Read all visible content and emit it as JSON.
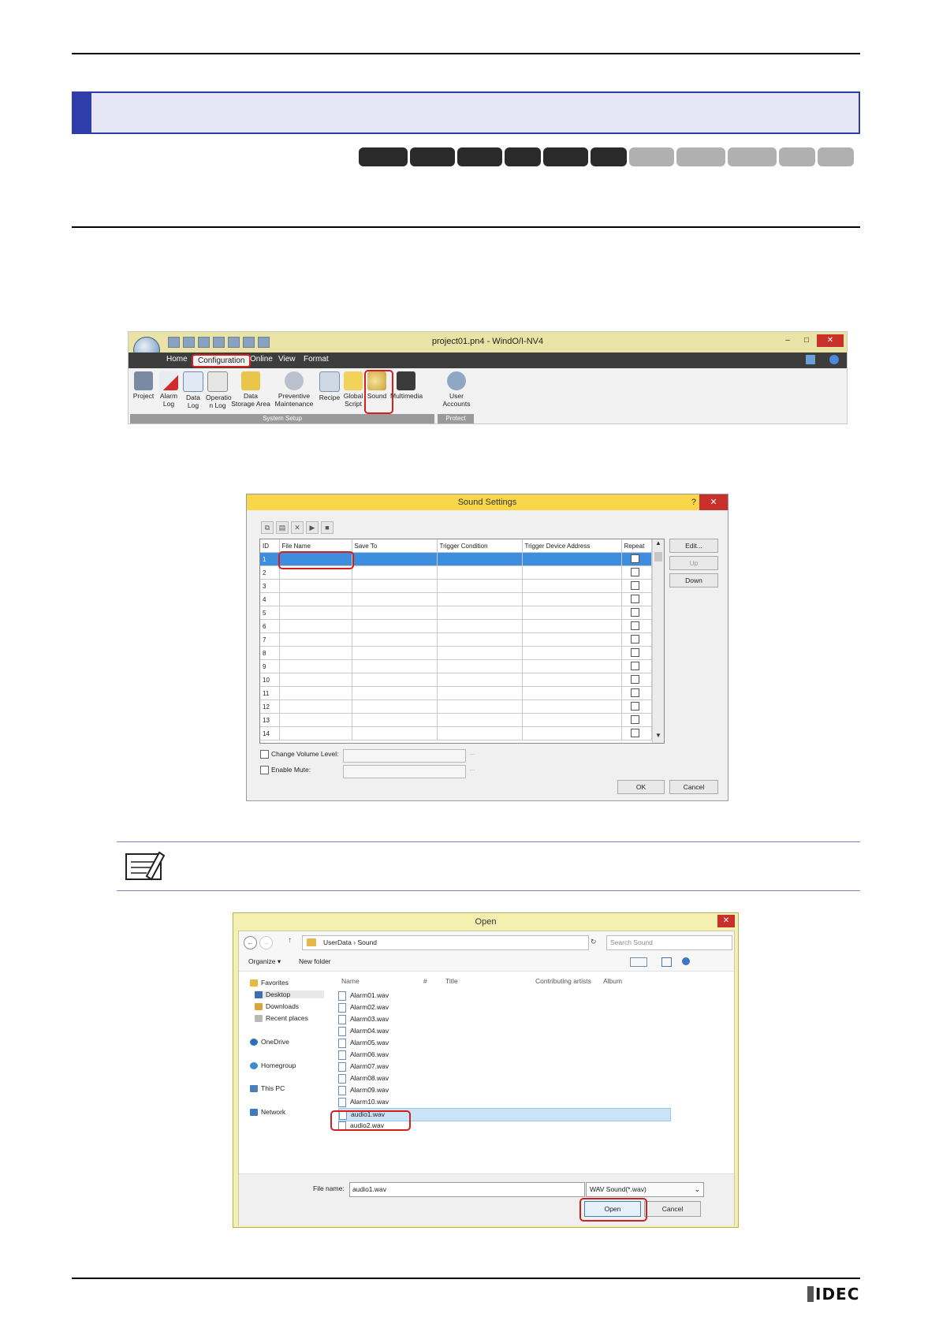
{
  "ribbon": {
    "window_title": "project01.pn4 - WindO/I-NV4",
    "tabs": [
      "Home",
      "Configuration",
      "Online",
      "View",
      "Format"
    ],
    "buttons": [
      "Project",
      "Alarm Log",
      "Data Log",
      "Operatio n Log",
      "Data Storage Area",
      "Preventive Maintenance",
      "Recipe",
      "Global Script",
      "Sound",
      "Multimedia",
      "User Accounts"
    ],
    "group_system": "System Setup",
    "group_protect": "Protect"
  },
  "sound_dialog": {
    "title": "Sound Settings",
    "help": "?",
    "columns": [
      "ID",
      "File Name",
      "Save To",
      "Trigger Condition",
      "Trigger Device Address",
      "Repeat"
    ],
    "row_ids": [
      "1",
      "2",
      "3",
      "4",
      "5",
      "6",
      "7",
      "8",
      "9",
      "10",
      "11",
      "12",
      "13",
      "14"
    ],
    "edit": "Edit...",
    "up": "Up",
    "down": "Down",
    "change_volume": "Change Volume Level:",
    "enable_mute": "Enable Mute:",
    "ok": "OK",
    "cancel": "Cancel"
  },
  "open_dialog": {
    "title": "Open",
    "path": "UserData  ›  Sound",
    "search_placeholder": "Search Sound",
    "organize": "Organize ▾",
    "new_folder": "New folder",
    "nav": {
      "favorites": "Favorites",
      "desktop": "Desktop",
      "downloads": "Downloads",
      "recent": "Recent places",
      "onedrive": "OneDrive",
      "homegroup": "Homegroup",
      "thispc": "This PC",
      "network": "Network"
    },
    "columns": {
      "name": "Name",
      "num": "#",
      "title": "Title",
      "artists": "Contributing artists",
      "album": "Album"
    },
    "files": [
      "Alarm01.wav",
      "Alarm02.wav",
      "Alarm03.wav",
      "Alarm04.wav",
      "Alarm05.wav",
      "Alarm06.wav",
      "Alarm07.wav",
      "Alarm08.wav",
      "Alarm09.wav",
      "Alarm10.wav",
      "audio1.wav",
      "audio2.wav"
    ],
    "file_name_label": "File name:",
    "file_name_value": "audio1.wav",
    "file_type": "WAV Sound(*.wav)",
    "open": "Open",
    "cancel": "Cancel"
  },
  "footer": {
    "logo": "IDEC"
  }
}
